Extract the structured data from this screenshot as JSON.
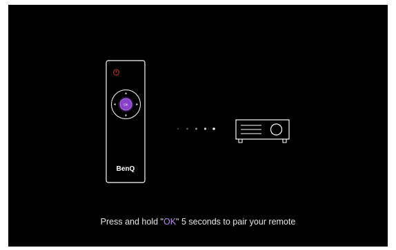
{
  "remote": {
    "brand": "BenQ",
    "ok_label": "OK"
  },
  "instruction": {
    "prefix": "Press and hold  \"",
    "key": "OK",
    "suffix": "\" 5 seconds  to pair your remote"
  },
  "colors": {
    "background": "#000000",
    "accent": "#8a3fc9",
    "power": "#c0392b",
    "text": "#e6e6e6"
  },
  "icons": {
    "power": "power-icon",
    "dpad": "dpad-icon",
    "projector": "projector-icon",
    "signal": "signal-dots-icon"
  }
}
